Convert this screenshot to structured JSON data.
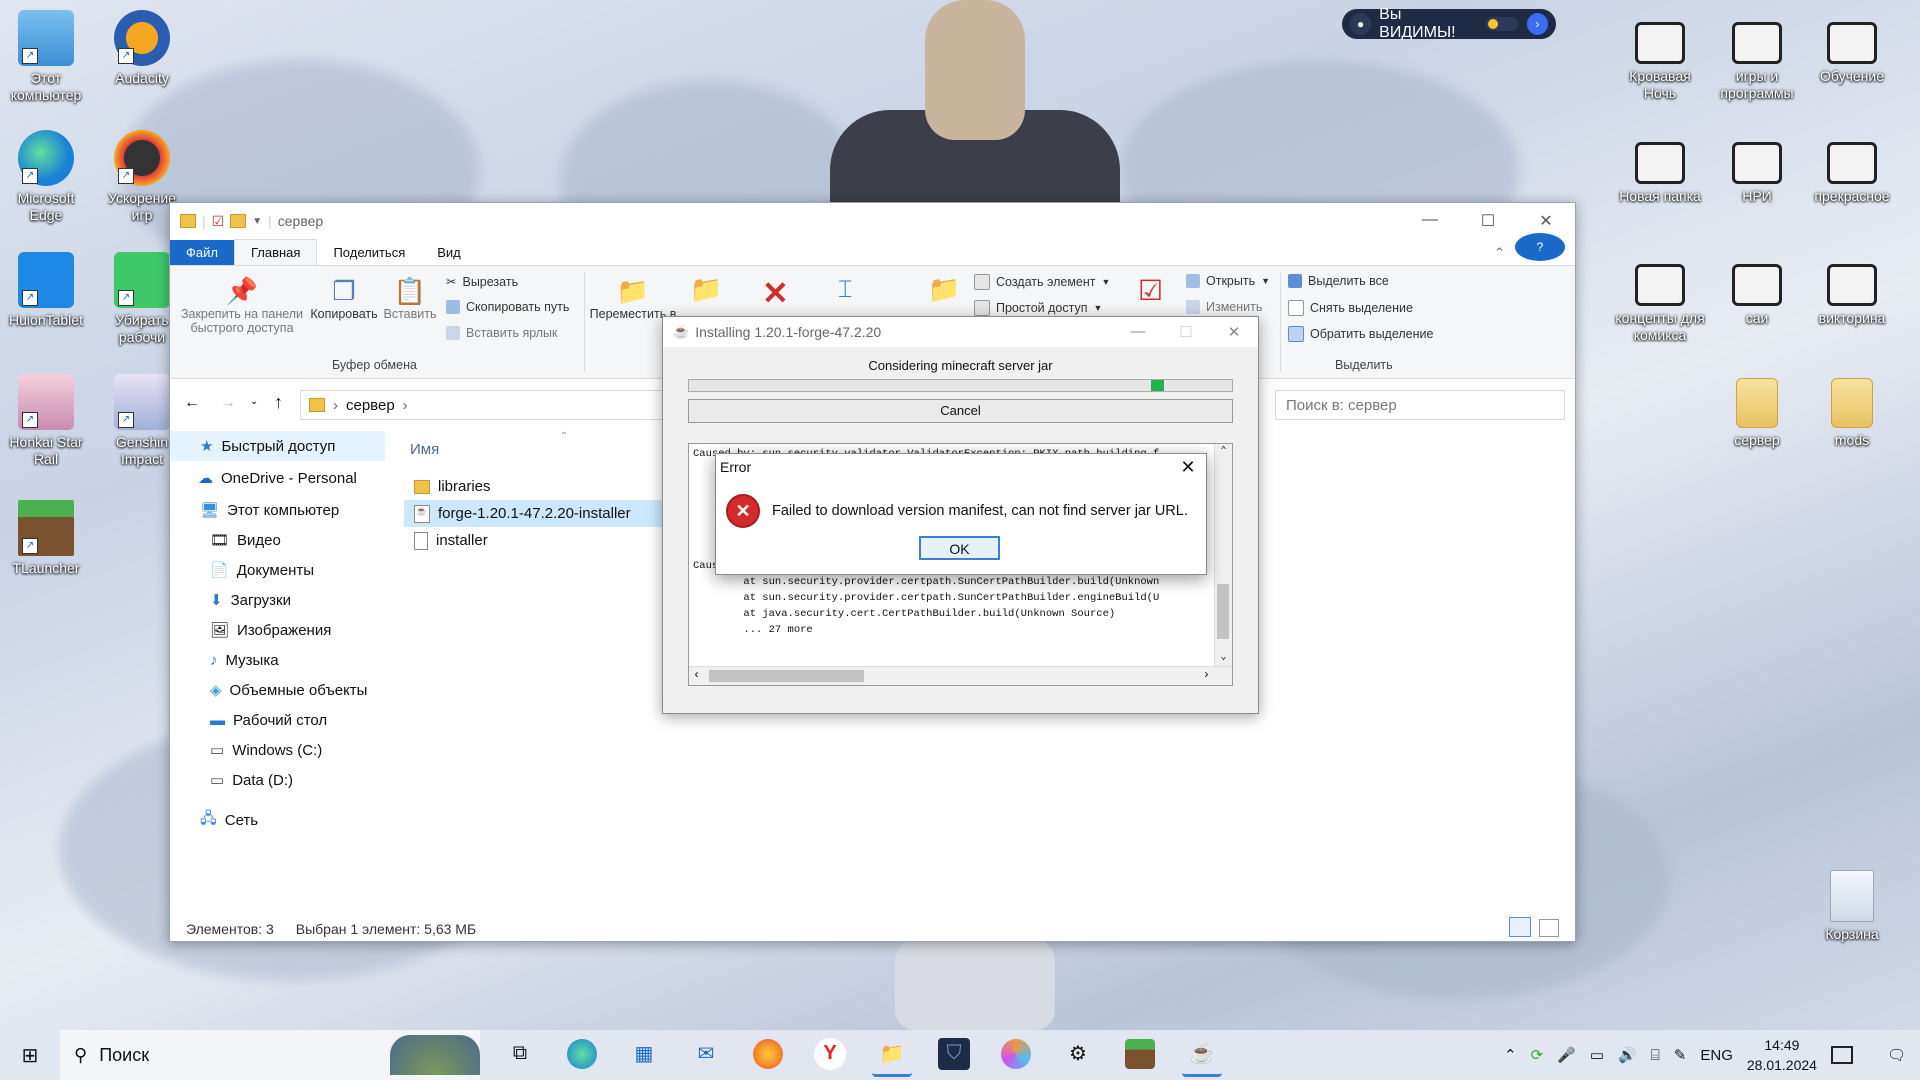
{
  "desktop": {
    "left_icons": [
      {
        "label": "Этот компьютер",
        "icon": "computer-icon"
      },
      {
        "label": "Audacity",
        "icon": "audacity-icon"
      },
      {
        "label": "Microsoft Edge",
        "icon": "edge-icon"
      },
      {
        "label": "Ускорение игр",
        "icon": "game-booster-icon"
      },
      {
        "label": "HuionTablet",
        "icon": "huion-icon"
      },
      {
        "label": "Убирать рабочи",
        "icon": "app-icon"
      },
      {
        "label": "Honkai Star Rail",
        "icon": "honkai-icon"
      },
      {
        "label": "Genshin Impact",
        "icon": "genshin-icon"
      },
      {
        "label": "TLauncher",
        "icon": "tlauncher-icon"
      }
    ],
    "right_icons": [
      {
        "label": "Кровавая Ночь"
      },
      {
        "label": "игры и программы"
      },
      {
        "label": "Обучение"
      },
      {
        "label": "Новая папка"
      },
      {
        "label": "НРИ"
      },
      {
        "label": "прекрасное"
      },
      {
        "label": "концепты для комикса"
      },
      {
        "label": "саи"
      },
      {
        "label": "викторина"
      },
      {
        "label": "сервер"
      },
      {
        "label": "mods"
      }
    ],
    "recycle_bin": "Корзина",
    "vk_banner": "Вы ВИДИМЫ!"
  },
  "explorer": {
    "title": "сервер",
    "tabs": [
      "Файл",
      "Главная",
      "Поделиться",
      "Вид"
    ],
    "ribbon": {
      "pin": "Закрепить на панели быстрого доступа",
      "copy": "Копировать",
      "paste": "Вставить",
      "cut": "Вырезать",
      "copy_path": "Скопировать путь",
      "paste_shortcut": "Вставить ярлык",
      "clipboard_group": "Буфер обмена",
      "move_to": "Переместить в",
      "new_item": "Создать элемент",
      "easy_access": "Простой доступ",
      "open": "Открыть",
      "edit": "Изменить",
      "select_all": "Выделить все",
      "select_none": "Снять выделение",
      "invert": "Обратить выделение",
      "select_group": "Выделить"
    },
    "address": {
      "crumb": "сервер",
      "search_placeholder": "Поиск в: сервер"
    },
    "nav": [
      {
        "label": "Быстрый доступ",
        "icon": "star-icon"
      },
      {
        "label": "OneDrive - Personal",
        "icon": "cloud-icon"
      },
      {
        "label": "Этот компьютер",
        "icon": "computer-icon"
      },
      {
        "label": "Видео",
        "icon": "video-icon"
      },
      {
        "label": "Документы",
        "icon": "documents-icon"
      },
      {
        "label": "Загрузки",
        "icon": "download-icon"
      },
      {
        "label": "Изображения",
        "icon": "images-icon"
      },
      {
        "label": "Музыка",
        "icon": "music-icon"
      },
      {
        "label": "Объемные объекты",
        "icon": "cube-icon"
      },
      {
        "label": "Рабочий стол",
        "icon": "desktop-icon"
      },
      {
        "label": "Windows (C:)",
        "icon": "drive-icon"
      },
      {
        "label": "Data (D:)",
        "icon": "drive-icon"
      },
      {
        "label": "Сеть",
        "icon": "network-icon"
      }
    ],
    "column_header": "Имя",
    "files": [
      "libraries",
      "forge-1.20.1-47.2.20-installer",
      "installer"
    ],
    "status": {
      "count": "Элементов: 3",
      "selected": "Выбран 1 элемент: 5,63 МБ"
    }
  },
  "installer": {
    "title": "Installing 1.20.1-forge-47.2.20",
    "status": "Considering minecraft server jar",
    "progress": 0.85,
    "cancel": "Cancel",
    "log": [
      "Caused by: sun.security.validator.ValidatorException: PKIX path building f",
      "",
      "",
      "",
      "",
      "",
      "",
      "Caused by: sun.security.provider.certpath.SunCertPathBuilderException: una",
      "        at sun.security.provider.certpath.SunCertPathBuilder.build(Unknown",
      "        at sun.security.provider.certpath.SunCertPathBuilder.engineBuild(U",
      "        at java.security.cert.CertPathBuilder.build(Unknown Source)",
      "        ... 27 more"
    ]
  },
  "error_dialog": {
    "title": "Error",
    "message": "Failed to download version manifest, can not find server jar URL.",
    "ok": "OK"
  },
  "taskbar": {
    "search_placeholder": "Поиск",
    "lang": "ENG",
    "time": "14:49",
    "date": "28.01.2024"
  }
}
